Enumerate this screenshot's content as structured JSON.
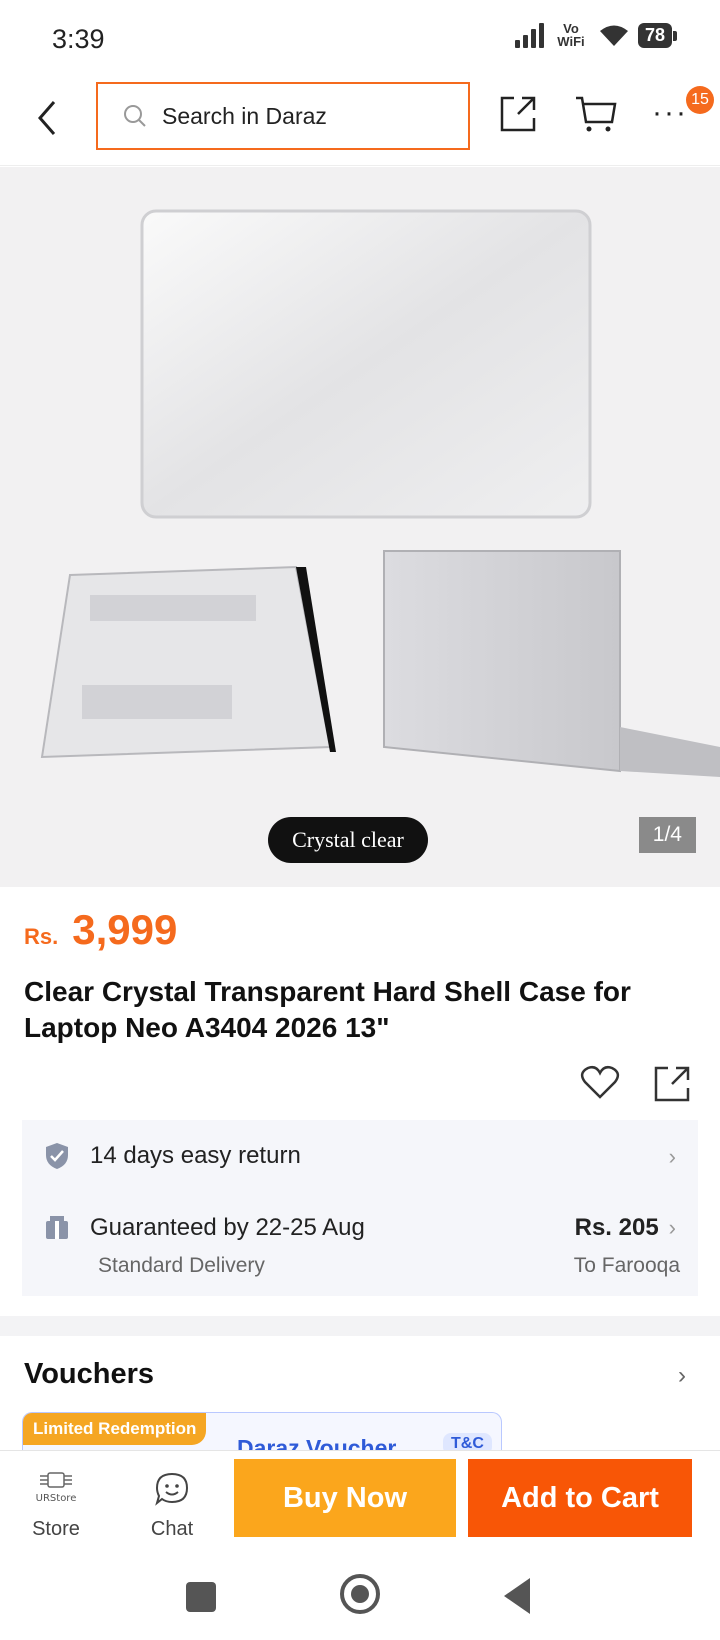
{
  "status_bar": {
    "time": "3:39",
    "network": "Vo WiFi",
    "battery": "78"
  },
  "header": {
    "search_placeholder": "Search in Daraz",
    "notification_count": "15"
  },
  "gallery": {
    "image_caption": "Crystal clear",
    "counter": "1/4"
  },
  "product": {
    "currency": "Rs.",
    "price": "3,999",
    "title": "Clear Crystal Transparent Hard Shell Case for Laptop Neo A3404 2026 13\""
  },
  "service": {
    "return_text": "14 days easy return",
    "delivery_text": "Guaranteed by 22-25 Aug",
    "delivery_type": "Standard Delivery",
    "delivery_fee": "Rs. 205",
    "delivery_to": "To Farooqa"
  },
  "vouchers": {
    "title": "Vouchers",
    "badge": "Limited Redemption",
    "voucher_name": "Daraz Voucher",
    "tc": "T&C"
  },
  "action_bar": {
    "store_label": "Store",
    "store_logo_text": "URStore",
    "chat_label": "Chat",
    "buy_now": "Buy Now",
    "add_to_cart": "Add to Cart"
  },
  "colors": {
    "accent": "#f56a1d",
    "buy_now": "#fba61c",
    "add_to_cart": "#f85606"
  }
}
